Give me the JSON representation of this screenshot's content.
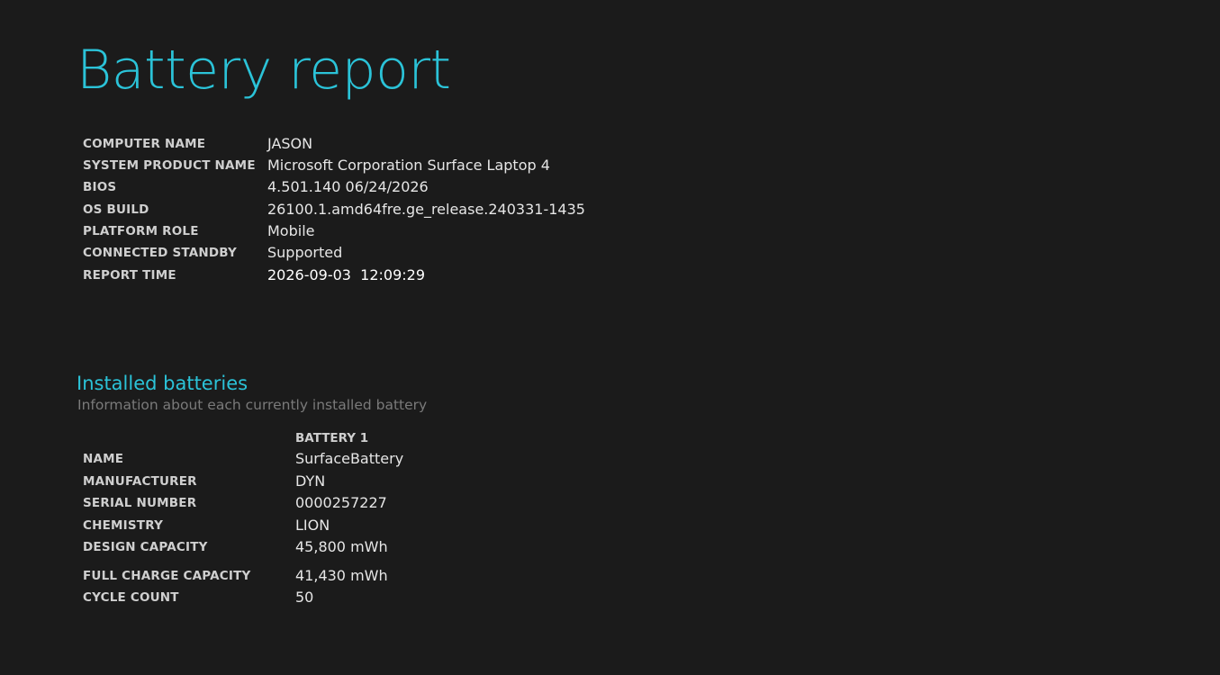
{
  "title": "Battery report",
  "system_info": [
    {
      "label": "COMPUTER NAME",
      "value": "JASON"
    },
    {
      "label": "SYSTEM PRODUCT NAME",
      "value": "Microsoft Corporation Surface Laptop 4"
    },
    {
      "label": "BIOS",
      "value": "4.501.140 06/24/2026"
    },
    {
      "label": "OS BUILD",
      "value": "26100.1.amd64fre.ge_release.240331-1435"
    },
    {
      "label": "PLATFORM ROLE",
      "value": "Mobile"
    },
    {
      "label": "CONNECTED STANDBY",
      "value": "Supported"
    },
    {
      "label": "REPORT TIME",
      "value": "2026-09-03  12:09:29"
    }
  ],
  "installed_batteries": {
    "title": "Installed batteries",
    "subtitle": "Information about each currently installed battery",
    "column_header": "BATTERY 1",
    "rows": [
      {
        "label": "NAME",
        "value": "SurfaceBattery"
      },
      {
        "label": "MANUFACTURER",
        "value": "DYN"
      },
      {
        "label": "SERIAL NUMBER",
        "value": "0000257227"
      },
      {
        "label": "CHEMISTRY",
        "value": "LION"
      },
      {
        "label": "DESIGN CAPACITY",
        "value": "45,800 mWh"
      },
      {
        "label": "FULL CHARGE CAPACITY",
        "value": "41,430 mWh"
      },
      {
        "label": "CYCLE COUNT",
        "value": "50"
      }
    ]
  },
  "colors": {
    "background": "#1b1b1b",
    "accent": "#2bc3d8",
    "label": "#cfcfcf",
    "value": "#e6e6e6",
    "muted": "#7a7a7a"
  }
}
